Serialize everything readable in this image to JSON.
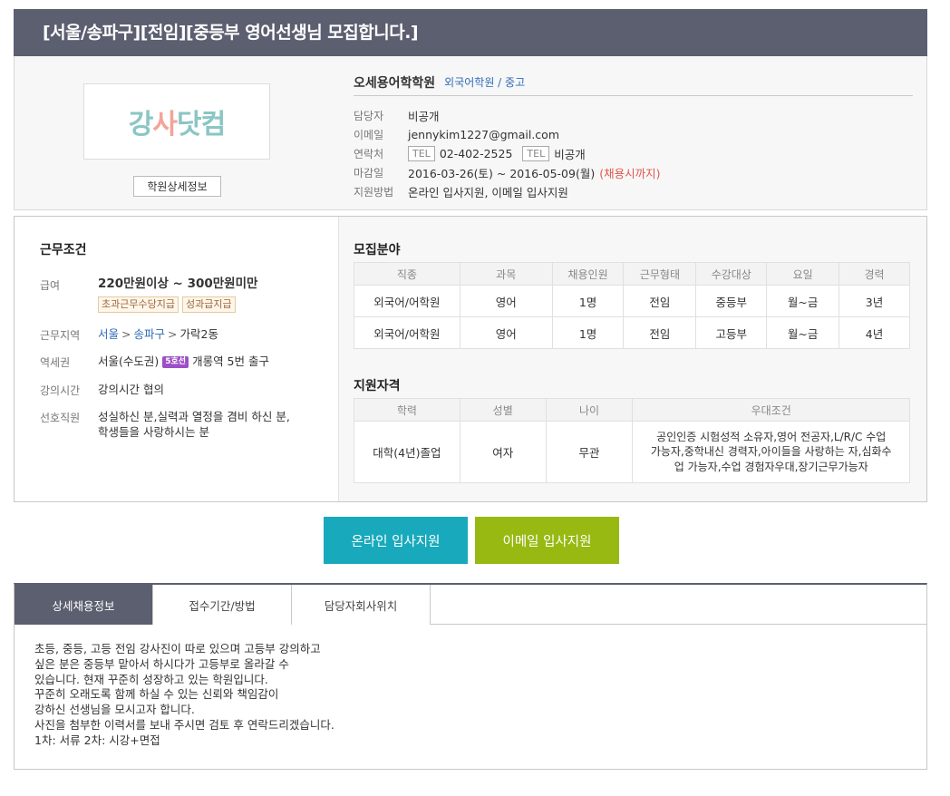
{
  "title": "[서울/송파구][전임][중등부 영어선생님 모집합니다.]",
  "company": {
    "logo_text_a": "강",
    "logo_text_b": "사",
    "logo_text_c": "닷컴",
    "detail_button": "학원상세정보",
    "name": "오세용어학학원",
    "category": "외국어학원 / 중고",
    "rows": {
      "manager_label": "담당자",
      "manager_value": "비공개",
      "email_label": "이메일",
      "email_value": "jennykim1227@gmail.com",
      "contact_label": "연락처",
      "tel_tag": "TEL",
      "phone_value": "02-402-2525",
      "phone2_value": "비공개",
      "deadline_label": "마감일",
      "deadline_value": "2016-03-26(토) ~ 2016-05-09(월)",
      "deadline_note": "(채용시까지)",
      "method_label": "지원방법",
      "method_value": "온라인 입사지원, 이메일 입사지원"
    }
  },
  "conditions": {
    "title": "근무조건",
    "salary_label": "급여",
    "salary_value": "220만원이상 ~ 300만원미만",
    "salary_tags": [
      "초과근무수당지급",
      "성과급지급"
    ],
    "area_label": "근무지역",
    "area_city": "서울",
    "area_district": "송파구",
    "area_dong": "가락2동",
    "station_label": "역세권",
    "station_region": "서울(수도권)",
    "station_line": "5호선",
    "station_exit": "개롱역 5번 출구",
    "lecture_label": "강의시간",
    "lecture_value": "강의시간 협의",
    "pref_label": "선호직원",
    "pref_value_1": "성실하신 분,실력과 열정을 겸비 하신 분,",
    "pref_value_2": "학생들을 사랑하시는 분"
  },
  "recruit": {
    "title": "모집분야",
    "headers": [
      "직종",
      "과목",
      "채용인원",
      "근무형태",
      "수강대상",
      "요일",
      "경력"
    ],
    "rows": [
      [
        "외국어/어학원",
        "영어",
        "1명",
        "전임",
        "중등부",
        "월~금",
        "3년"
      ],
      [
        "외국어/어학원",
        "영어",
        "1명",
        "전임",
        "고등부",
        "월~금",
        "4년"
      ]
    ]
  },
  "qualification": {
    "title": "지원자격",
    "headers": [
      "학력",
      "성별",
      "나이",
      "우대조건"
    ],
    "row": [
      "대학(4년)졸업",
      "여자",
      "무관"
    ],
    "pref_lines": [
      "공인인증 시험성적 소유자,영어 전공자,L/R/C 수업",
      "가능자,중학내신 경력자,아이들을 사랑하는 자,심화수",
      "업 가능자,수업 경험자우대,장기근무가능자"
    ]
  },
  "buttons": {
    "online": "온라인 입사지원",
    "email": "이메일 입사지원"
  },
  "tabs": [
    "상세채용정보",
    "접수기간/방법",
    "담당자회사위치"
  ],
  "description": [
    "초등, 중등, 고등 전임 강사진이 따로 있으며 고등부 강의하고",
    "싶은 분은 중등부 맡아서 하시다가 고등부로 올라갈 수",
    "있습니다. 현재 꾸준히 성장하고 있는 학원입니다.",
    "꾸준히 오래도록 함께 하실 수 있는 신뢰와 책임감이",
    "강하신 선생님을 모시고자 합니다.",
    "사진을 첨부한 이력서를 보내 주시면 검토 후 연락드리겠습니다.",
    "1차: 서류 2차: 시강+면접"
  ],
  "colors": {
    "header_bg": "#5b5f70",
    "online_btn": "#18aabc",
    "email_btn": "#97b912",
    "link": "#2f6bb7",
    "note_red": "#e0564b"
  }
}
